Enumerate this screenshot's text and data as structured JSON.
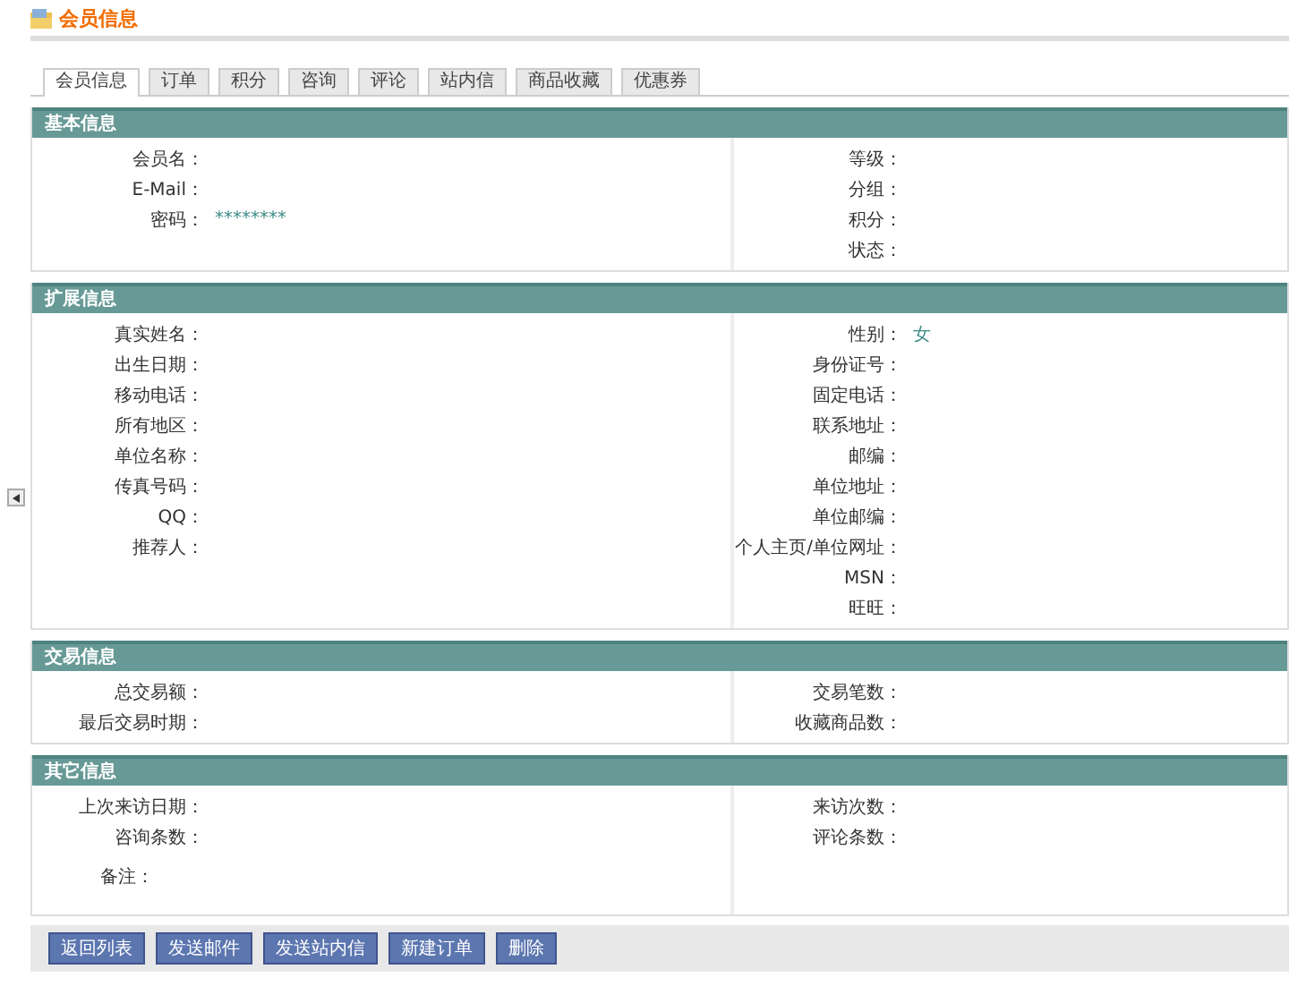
{
  "page_title": "会员信息",
  "tabs": [
    {
      "label": "会员信息",
      "selected": true
    },
    {
      "label": "订单",
      "selected": false
    },
    {
      "label": "积分",
      "selected": false
    },
    {
      "label": "咨询",
      "selected": false
    },
    {
      "label": "评论",
      "selected": false
    },
    {
      "label": "站内信",
      "selected": false
    },
    {
      "label": "商品收藏",
      "selected": false
    },
    {
      "label": "优惠券",
      "selected": false
    }
  ],
  "sections": [
    {
      "title": "基本信息",
      "left": [
        {
          "label": "会员名："
        },
        {
          "label": "E-Mail："
        },
        {
          "label": "密码：",
          "value": "********"
        }
      ],
      "right": [
        {
          "label": "等级："
        },
        {
          "label": "分组："
        },
        {
          "label": "积分："
        },
        {
          "label": "状态："
        }
      ]
    },
    {
      "title": "扩展信息",
      "left": [
        {
          "label": "真实姓名："
        },
        {
          "label": "出生日期："
        },
        {
          "label": "移动电话："
        },
        {
          "label": "所有地区："
        },
        {
          "label": "单位名称："
        },
        {
          "label": "传真号码："
        },
        {
          "label": "QQ："
        },
        {
          "label": "推荐人："
        }
      ],
      "right": [
        {
          "label": "性别：",
          "value": "女"
        },
        {
          "label": "身份证号："
        },
        {
          "label": "固定电话："
        },
        {
          "label": "联系地址："
        },
        {
          "label": "邮编："
        },
        {
          "label": "单位地址："
        },
        {
          "label": "单位邮编："
        },
        {
          "label": "个人主页/单位网址："
        },
        {
          "label": "MSN："
        },
        {
          "label": "旺旺："
        }
      ]
    },
    {
      "title": "交易信息",
      "left": [
        {
          "label": "总交易额："
        },
        {
          "label": "最后交易时期："
        }
      ],
      "right": [
        {
          "label": "交易笔数："
        },
        {
          "label": "收藏商品数："
        }
      ]
    },
    {
      "title": "其它信息",
      "left": [
        {
          "label": "上次来访日期："
        },
        {
          "label": "咨询条数："
        }
      ],
      "right": [
        {
          "label": "来访次数："
        },
        {
          "label": "评论条数："
        }
      ],
      "note": {
        "label": "备注："
      }
    }
  ],
  "buttons": [
    "返回列表",
    "发送邮件",
    "发送站内信",
    "新建订单",
    "删除"
  ]
}
